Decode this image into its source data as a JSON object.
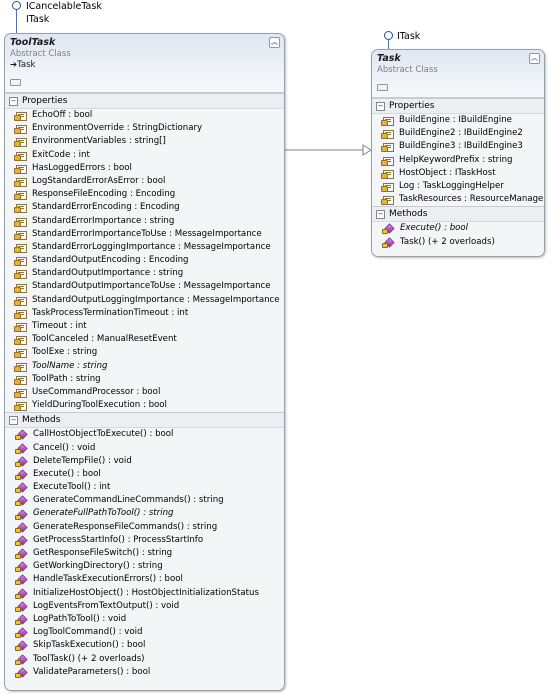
{
  "interfaces": {
    "tooltask": [
      "ICancelableTask",
      "ITask"
    ],
    "task": [
      "ITask"
    ]
  },
  "tooltask": {
    "name": "ToolTask",
    "stereotype": "Abstract Class",
    "base": "Task",
    "properties_label": "Properties",
    "methods_label": "Methods",
    "properties": [
      {
        "text": "EchoOff : bool",
        "italic": false
      },
      {
        "text": "EnvironmentOverride : StringDictionary",
        "italic": false
      },
      {
        "text": "EnvironmentVariables : string[]",
        "italic": false
      },
      {
        "text": "ExitCode : int",
        "italic": false
      },
      {
        "text": "HasLoggedErrors : bool",
        "italic": false
      },
      {
        "text": "LogStandardErrorAsError : bool",
        "italic": false
      },
      {
        "text": "ResponseFileEncoding : Encoding",
        "italic": false
      },
      {
        "text": "StandardErrorEncoding : Encoding",
        "italic": false
      },
      {
        "text": "StandardErrorImportance : string",
        "italic": false
      },
      {
        "text": "StandardErrorImportanceToUse : MessageImportance",
        "italic": false
      },
      {
        "text": "StandardErrorLoggingImportance : MessageImportance",
        "italic": false
      },
      {
        "text": "StandardOutputEncoding : Encoding",
        "italic": false
      },
      {
        "text": "StandardOutputImportance : string",
        "italic": false
      },
      {
        "text": "StandardOutputImportanceToUse : MessageImportance",
        "italic": false
      },
      {
        "text": "StandardOutputLoggingImportance : MessageImportance",
        "italic": false
      },
      {
        "text": "TaskProcessTerminationTimeout : int",
        "italic": false
      },
      {
        "text": "Timeout : int",
        "italic": false
      },
      {
        "text": "ToolCanceled : ManualResetEvent",
        "italic": false
      },
      {
        "text": "ToolExe : string",
        "italic": false
      },
      {
        "text": "ToolName : string",
        "italic": true
      },
      {
        "text": "ToolPath : string",
        "italic": false
      },
      {
        "text": "UseCommandProcessor : bool",
        "italic": false
      },
      {
        "text": "YieldDuringToolExecution : bool",
        "italic": false
      }
    ],
    "methods": [
      {
        "text": "CallHostObjectToExecute() : bool",
        "italic": false
      },
      {
        "text": "Cancel() : void",
        "italic": false
      },
      {
        "text": "DeleteTempFile() : void",
        "italic": false
      },
      {
        "text": "Execute() : bool",
        "italic": false
      },
      {
        "text": "ExecuteTool() : int",
        "italic": false
      },
      {
        "text": "GenerateCommandLineCommands() : string",
        "italic": false
      },
      {
        "text": "GenerateFullPathToTool() : string",
        "italic": true
      },
      {
        "text": "GenerateResponseFileCommands() : string",
        "italic": false
      },
      {
        "text": "GetProcessStartInfo() : ProcessStartInfo",
        "italic": false
      },
      {
        "text": "GetResponseFileSwitch() : string",
        "italic": false
      },
      {
        "text": "GetWorkingDirectory() : string",
        "italic": false
      },
      {
        "text": "HandleTaskExecutionErrors() : bool",
        "italic": false
      },
      {
        "text": "InitializeHostObject() : HostObjectInitializationStatus",
        "italic": false
      },
      {
        "text": "LogEventsFromTextOutput() : void",
        "italic": false
      },
      {
        "text": "LogPathToTool() : void",
        "italic": false
      },
      {
        "text": "LogToolCommand() : void",
        "italic": false
      },
      {
        "text": "SkipTaskExecution() : bool",
        "italic": false
      },
      {
        "text": "ToolTask() (+ 2 overloads)",
        "italic": false
      },
      {
        "text": "ValidateParameters() : bool",
        "italic": false
      }
    ]
  },
  "task": {
    "name": "Task",
    "stereotype": "Abstract Class",
    "properties_label": "Properties",
    "methods_label": "Methods",
    "properties": [
      {
        "text": "BuildEngine : IBuildEngine",
        "italic": false
      },
      {
        "text": "BuildEngine2 : IBuildEngine2",
        "italic": false
      },
      {
        "text": "BuildEngine3 : IBuildEngine3",
        "italic": false
      },
      {
        "text": "HelpKeywordPrefix : string",
        "italic": false
      },
      {
        "text": "HostObject : ITaskHost",
        "italic": false
      },
      {
        "text": "Log : TaskLoggingHelper",
        "italic": false
      },
      {
        "text": "TaskResources : ResourceManager",
        "italic": false
      }
    ],
    "methods": [
      {
        "text": "Execute() : bool",
        "italic": true
      },
      {
        "text": "Task() (+ 2 overloads)",
        "italic": false
      }
    ]
  },
  "icons": {
    "property": "property-icon",
    "method": "method-icon",
    "collapse": "double-chevron-up-icon",
    "interface": "lollipop-interface-icon"
  }
}
